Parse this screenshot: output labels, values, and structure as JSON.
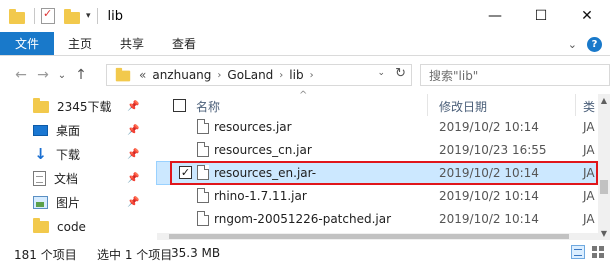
{
  "window": {
    "title": "lib",
    "quick_access_dropdown": "▾",
    "controls": {
      "minimize": "—",
      "maximize": "☐",
      "close": "✕"
    }
  },
  "ribbon": {
    "tabs": [
      "文件",
      "主页",
      "共享",
      "查看"
    ],
    "expand_glyph": "⌄",
    "help_glyph": "?"
  },
  "nav": {
    "back": "←",
    "forward": "→",
    "recent_dropdown": "⌄",
    "up": "↑"
  },
  "address": {
    "overflow": "«",
    "crumbs": [
      "anzhuang",
      "GoLand",
      "lib"
    ],
    "separator": "›",
    "dropdown": "⌄",
    "refresh": "↻"
  },
  "search": {
    "placeholder": "搜索\"lib\""
  },
  "sidebar": {
    "items": [
      {
        "label": "2345下载",
        "icon": "folder-icon",
        "pinned": true
      },
      {
        "label": "桌面",
        "icon": "desktop-icon",
        "pinned": true
      },
      {
        "label": "下载",
        "icon": "download-icon",
        "pinned": true
      },
      {
        "label": "文档",
        "icon": "document-icon",
        "pinned": true
      },
      {
        "label": "图片",
        "icon": "pictures-icon",
        "pinned": true
      },
      {
        "label": "code",
        "icon": "folder-icon",
        "pinned": false
      }
    ],
    "pin_glyph": "📌"
  },
  "filelist": {
    "columns": {
      "name": "名称",
      "date": "修改日期",
      "type": "类"
    },
    "sort_indicator": "^",
    "rows": [
      {
        "name": "resources.jar",
        "date": "2019/10/2 10:14",
        "type": "JA",
        "selected": false
      },
      {
        "name": "resources_cn.jar",
        "date": "2019/10/23 16:55",
        "type": "JA",
        "selected": false
      },
      {
        "name": "resources_en.jar-",
        "date": "2019/10/2 10:14",
        "type": "JA",
        "selected": true,
        "check": "✓"
      },
      {
        "name": "rhino-1.7.11.jar",
        "date": "2019/10/2 10:14",
        "type": "JA",
        "selected": false
      },
      {
        "name": "rngom-20051226-patched.jar",
        "date": "2019/10/2 10:14",
        "type": "JA",
        "selected": false
      }
    ]
  },
  "scrollbar": {
    "up": "▲",
    "down": "▼"
  },
  "status": {
    "count": "181 个项目",
    "selection": "选中 1 个项目",
    "size": "35.3 MB"
  },
  "colors": {
    "file_tab": "#1979ca",
    "selection": "#cce8ff",
    "highlight_border": "#e0161b",
    "folder": "#f2c94c"
  }
}
